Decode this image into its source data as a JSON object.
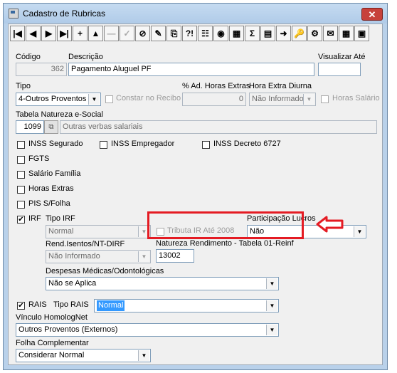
{
  "window": {
    "title": "Cadastro de Rubricas",
    "close_label": "✕"
  },
  "toolbar": {
    "buttons": [
      "|◀",
      "◀",
      "▶",
      "▶|",
      "+",
      "▲",
      "—",
      "✓",
      "⊘",
      "✎",
      "⎘",
      "?!",
      "☷",
      "◉",
      "▦",
      "Σ",
      "▤",
      "➜",
      "🔑",
      "⚙",
      "✉",
      "▦",
      "▣"
    ]
  },
  "form": {
    "codigo_label": "Código",
    "codigo_value": "362",
    "descricao_label": "Descrição",
    "descricao_value": "Pagamento Aluguel PF",
    "visualizar_label": "Visualizar Até",
    "visualizar_value": "",
    "tipo_label": "Tipo",
    "tipo_value": "4-Outros Proventos",
    "constar_label": "Constar no Recibo",
    "ad_horas_label": "% Ad. Horas Extras",
    "ad_horas_value": "0",
    "hora_diurna_label": "Hora Extra Diurna",
    "hora_diurna_value": "Não Informado",
    "horas_salario_label": "Horas Salário",
    "natureza_label": "Tabela Natureza e-Social",
    "natureza_code": "1099",
    "natureza_desc": "Outras verbas salariais",
    "inss_segurado": "INSS Segurado",
    "inss_empregador": "INSS Empregador",
    "inss_decreto": "INSS Decreto 6727",
    "fgts": "FGTS",
    "salario_familia": "Salário Família",
    "horas_extras": "Horas Extras",
    "pis": "PIS S/Folha",
    "irf": "IRF",
    "tipo_irf_label": "Tipo IRF",
    "tipo_irf_value": "Normal",
    "tributa_label": "Tributa IR Até 2008",
    "participacao_label": "Participação Lucros",
    "participacao_value": "Não",
    "rend_label": "Rend.Isentos/NT-DIRF",
    "rend_value": "Não Informado",
    "natureza_rend_label": "Natureza Rendimento - Tabela 01-Reinf",
    "natureza_rend_value": "13002",
    "despesas_label": "Despesas Médicas/Odontológicas",
    "despesas_value": "Não se Aplica",
    "rais": "RAIS",
    "tipo_rais_label": "Tipo RAIS",
    "tipo_rais_value": "Normal",
    "vinculo_label": "Vínculo HomologNet",
    "vinculo_value": "Outros Proventos (Externos)",
    "folha_label": "Folha Complementar",
    "folha_value": "Considerar Normal"
  },
  "checks": {
    "irf_checked": "✔",
    "rais_checked": "✔"
  },
  "colors": {
    "highlight": "#e41b23",
    "selection": "#3399ff"
  }
}
